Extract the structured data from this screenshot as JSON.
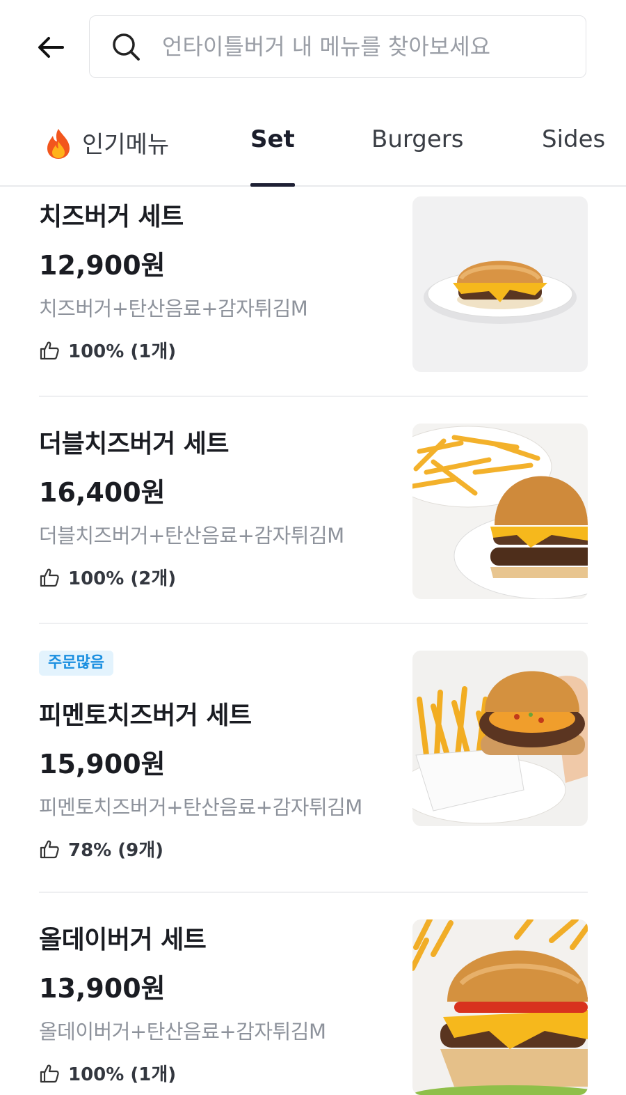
{
  "header": {
    "back_label": "back",
    "search": {
      "placeholder": "언타이틀버거 내 메뉴를 찾아보세요",
      "value": ""
    }
  },
  "tabs": [
    {
      "label": "인기메뉴",
      "icon": "fire-icon",
      "active": false
    },
    {
      "label": "Set",
      "active": true
    },
    {
      "label": "Burgers",
      "active": false
    },
    {
      "label": "Sides",
      "active": false
    }
  ],
  "menu_items": [
    {
      "title": "치즈버거 세트",
      "price": "12,900원",
      "description": "치즈버거+탄산음료+감자튀김M",
      "rating": "100% (1개)",
      "badge": ""
    },
    {
      "title": "더블치즈버거 세트",
      "price": "16,400원",
      "description": "더블치즈버거+탄산음료+감자튀김M",
      "rating": "100% (2개)",
      "badge": ""
    },
    {
      "title": "피멘토치즈버거 세트",
      "price": "15,900원",
      "description": "피멘토치즈버거+탄산음료+감자튀김M",
      "rating": "78% (9개)",
      "badge": "주문많음"
    },
    {
      "title": "올데이버거 세트",
      "price": "13,900원",
      "description": "올데이버거+탄산음료+감자튀김M",
      "rating": "100% (1개)",
      "badge": ""
    }
  ],
  "colors": {
    "badge_bg": "#e3f3fd",
    "badge_text": "#1a8fe0",
    "tab_indicator": "#1e2034"
  }
}
